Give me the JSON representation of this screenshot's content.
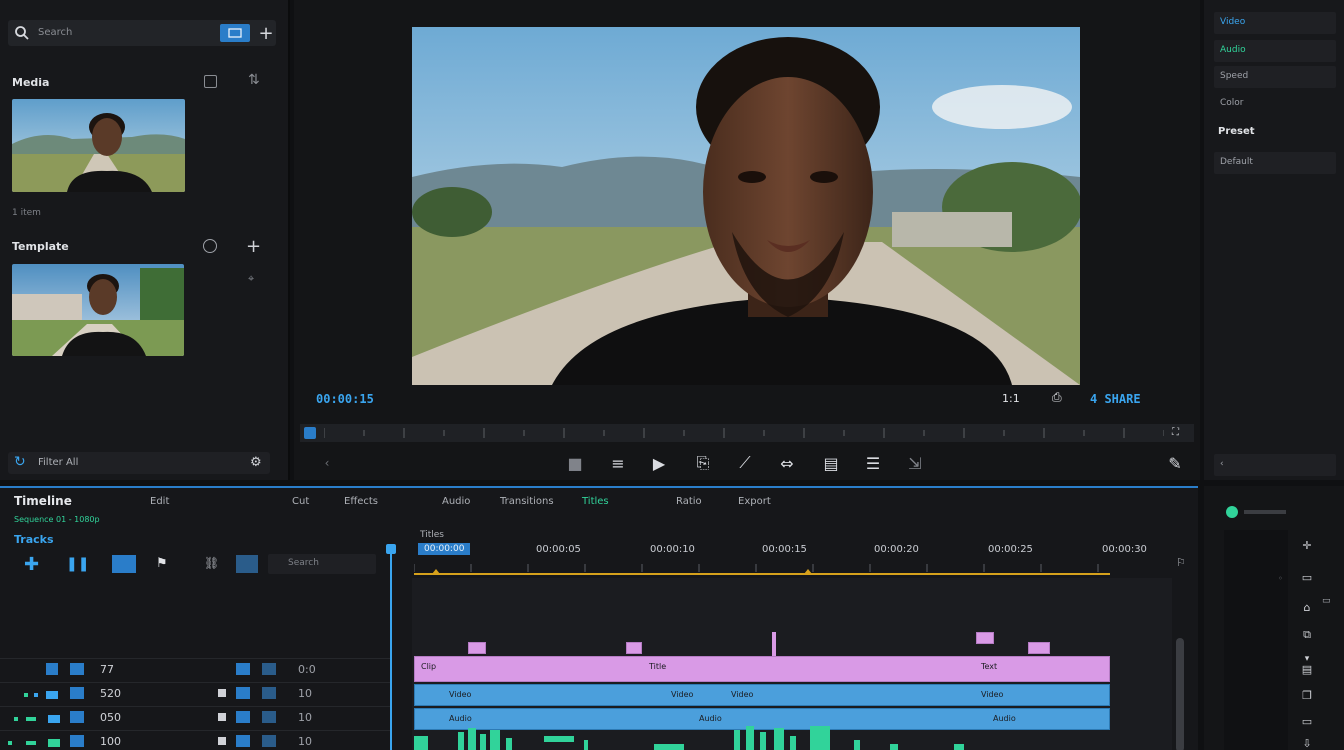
{
  "media": {
    "search_placeholder": "Search",
    "section1_title": "Media",
    "section1_meta": "1 item",
    "section2_title": "Template",
    "footer_label": "Filter  All"
  },
  "preview": {
    "timecode_left": "00:00:15",
    "timecode_right": "4 SHARE",
    "zoom": "1:1"
  },
  "right": {
    "rows": [
      "Video",
      "Audio",
      "Speed",
      "Color"
    ],
    "section": "Preset",
    "dropdown": "Default"
  },
  "timeline": {
    "title": "Timeline",
    "subtitle": "Sequence 01 - 1080p",
    "tracks_label": "Tracks",
    "tabs": [
      "Edit",
      "Cut",
      "Effects",
      "Audio",
      "Transitions",
      "Ratio",
      "Export"
    ],
    "active_tab": "Titles",
    "ruler_badge": "00:00:00",
    "ruler_ticks": [
      "00:00:05",
      "00:00:10",
      "00:00:15",
      "00:00:20",
      "00:00:25",
      "00:00:30"
    ],
    "rows": [
      {
        "id": "V3",
        "value": "77",
        "vol": "0:0"
      },
      {
        "id": "V2",
        "value": "520",
        "vol": "10"
      },
      {
        "id": "V1",
        "value": "050",
        "vol": "10"
      },
      {
        "id": "A1",
        "value": "100",
        "vol": "10"
      }
    ],
    "pink_labels": [
      "Clip",
      "Title",
      "Text"
    ],
    "blue_labels": [
      "Video",
      "Video",
      "Video",
      "Video",
      "Audio",
      "Audio",
      "Audio"
    ]
  },
  "colors": {
    "accent": "#2a7dc9",
    "timecode": "#3aa5ef",
    "pink_clip": "#d99ae6",
    "blue_clip": "#4b9fdc",
    "green_wave": "#31d39a"
  }
}
